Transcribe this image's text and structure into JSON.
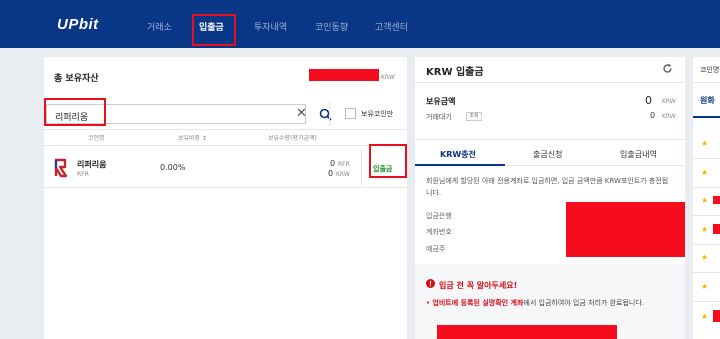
{
  "header": {
    "logo": "UPbit",
    "nav": [
      "거래소",
      "입출금",
      "투자내역",
      "코인동향",
      "고객센터"
    ]
  },
  "balance_panel": {
    "title": "총 보유자산",
    "currency": "KRW",
    "search_value": "리퍼리움",
    "clear_label": "✕",
    "checkbox_label": "보유코인만",
    "columns": [
      "코인명",
      "보유비중 ↕",
      "보유수량(평가금액)"
    ],
    "rows": [
      {
        "name": "리퍼리움",
        "symbol": "RFR",
        "ratio": "0.00%",
        "amount": "0",
        "amount_unit": "RFR",
        "value": "0",
        "value_unit": "KRW",
        "action": "입출금"
      }
    ]
  },
  "krw_panel": {
    "title": "KRW 입출금",
    "held_label": "보유금액",
    "held_value": "0",
    "held_unit": "KRW",
    "pending_label": "거래대기",
    "pending_button": "조회",
    "pending_value": "0",
    "pending_unit": "KRW",
    "tabs": [
      "KRW충전",
      "출금신청",
      "입출금내역"
    ],
    "notice": "회원님에게 할당된 아래 전용계좌로 입금하면, 입금 금액만큼 KRW포인트가 충전됩니다.",
    "fields": [
      "입금은행",
      "계좌번호",
      "예금주"
    ],
    "warning_title": "입금 전 꼭 알아두세요!",
    "warning_highlight": "업비트에 등록된 실명확인 계좌",
    "warning_rest": "에서 입금하여야 입금 처리가 완료됩니다."
  },
  "right_panel": {
    "title": "코인명",
    "tab": "원화"
  },
  "colors": {
    "brand": "#093687",
    "accent_red": "#e8101b",
    "star": "#f7b500"
  }
}
